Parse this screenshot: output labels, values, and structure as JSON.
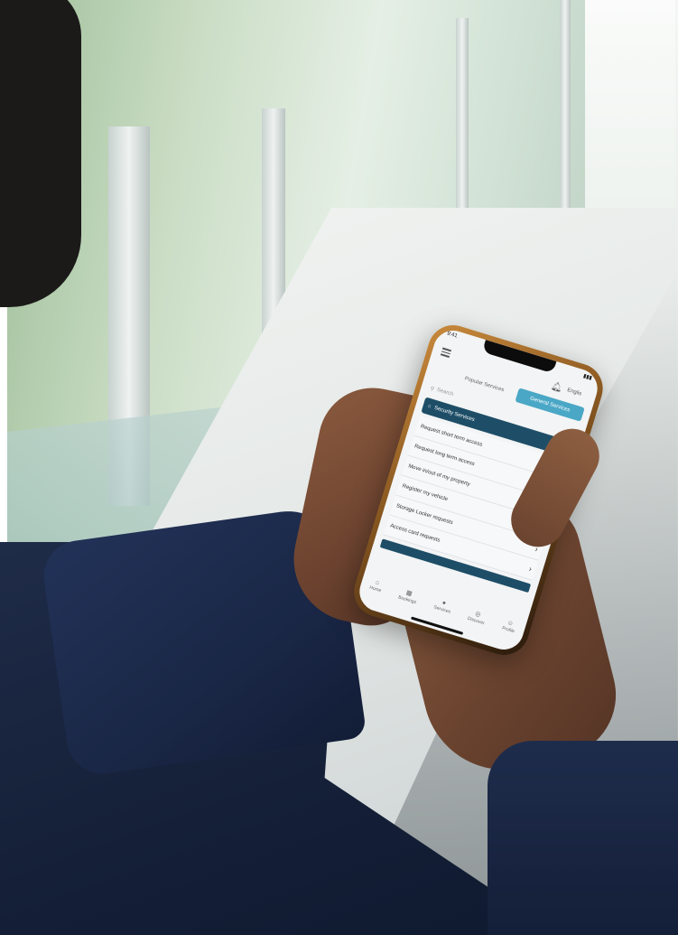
{
  "scene": {
    "description_items": [
      "window-wall",
      "corridor-floor",
      "person-holding-phone"
    ]
  },
  "phone": {
    "status": {
      "time": "9:41",
      "signal": "▮▮▮"
    },
    "header": {
      "language": "Englis",
      "bell_icon": "bell-icon",
      "menu_icon": "menu-icon"
    },
    "tabs": [
      {
        "label": "Popular Services",
        "active": false
      },
      {
        "label": "General Services",
        "active": true
      }
    ],
    "search": {
      "placeholder": "Search"
    },
    "section": {
      "title": "Security Services",
      "icon": "shield-icon"
    },
    "items": [
      {
        "label": "Request short term access"
      },
      {
        "label": "Request long term access"
      },
      {
        "label": "Move in/out of my property"
      },
      {
        "label": "Register my vehicle"
      },
      {
        "label": "Storage Locker requests"
      },
      {
        "label": "Access card requests"
      }
    ],
    "nav": [
      {
        "label": "Home",
        "icon": "home-icon"
      },
      {
        "label": "Bookings",
        "icon": "calendar-icon"
      },
      {
        "label": "Services",
        "icon": "services-icon"
      },
      {
        "label": "Discover",
        "icon": "compass-icon"
      },
      {
        "label": "Profile",
        "icon": "profile-icon"
      }
    ]
  },
  "colors": {
    "accent": "#4aa7c6",
    "header_bar": "#1e4e67",
    "shirt": "#1a2746"
  }
}
